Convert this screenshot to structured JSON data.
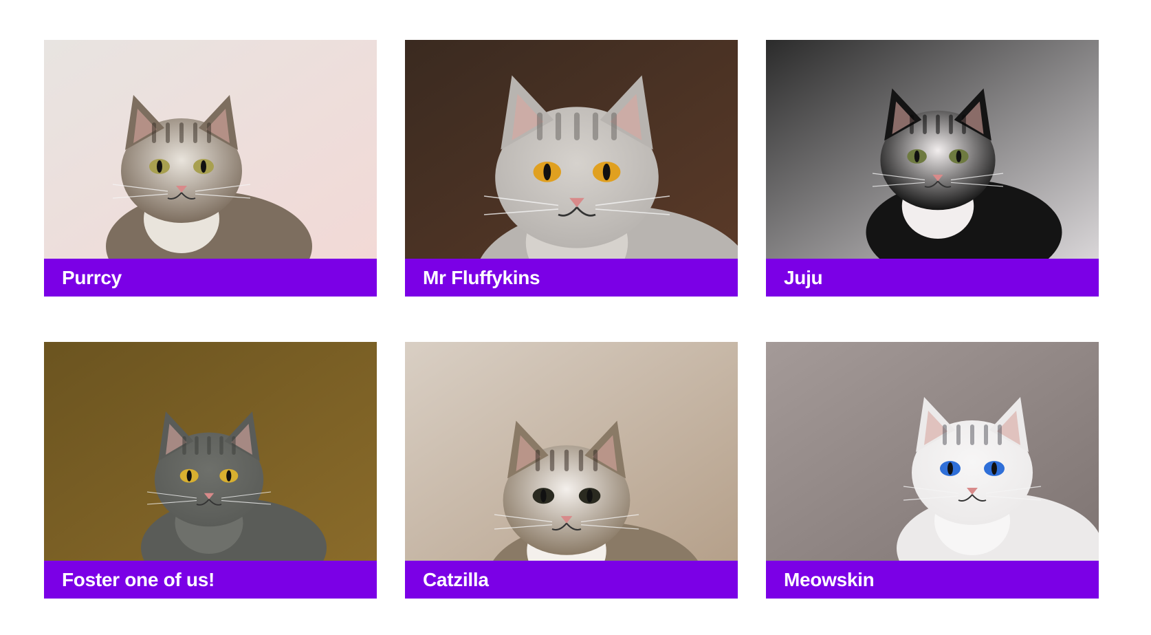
{
  "cats": [
    {
      "name": "Purrcy",
      "photo": "tabby-cat-photo",
      "bg": "#e8e4e1",
      "accent": "#f2d9d6",
      "fur": "#7d6e5f",
      "stripe": "#3e342b",
      "eye": "#a8a050",
      "chest": "#e9e4dc"
    },
    {
      "name": "Mr Fluffykins",
      "photo": "silver-tabby-cat-photo",
      "bg": "#3a2a20",
      "accent": "#5a3a28",
      "fur": "#b8b4b0",
      "stripe": "#6e6a66",
      "eye": "#e0a020",
      "chest": "#d6d2cd"
    },
    {
      "name": "Juju",
      "photo": "tuxedo-cat-photo",
      "bg": "#2b2b2b",
      "accent": "#d9d6d8",
      "fur": "#141414",
      "stripe": "#0a0a0a",
      "eye": "#6e7a40",
      "chest": "#f2eeee"
    },
    {
      "name": "Foster one of us!",
      "photo": "grey-kitten-photo",
      "bg": "#6b5420",
      "accent": "#8a6b2a",
      "fur": "#5a5c58",
      "stripe": "#3e403c",
      "eye": "#d8b030",
      "chest": "#6e706b"
    },
    {
      "name": "Catzilla",
      "photo": "meowing-cat-photo",
      "bg": "#d9cfc4",
      "accent": "#b5a08a",
      "fur": "#8a7a66",
      "stripe": "#3a3028",
      "eye": "#2a2a20",
      "chest": "#f4f0ec"
    },
    {
      "name": "Meowskin",
      "photo": "siamese-cat-photo",
      "bg": "#a49a98",
      "accent": "#7e7472",
      "fur": "#eceaea",
      "stripe": "#5e5e66",
      "eye": "#2f6fd8",
      "chest": "#f7f6f6"
    }
  ],
  "colors": {
    "caption_bg": "#7b00e6",
    "caption_text": "#ffffff",
    "page_bg": "#ffffff"
  }
}
